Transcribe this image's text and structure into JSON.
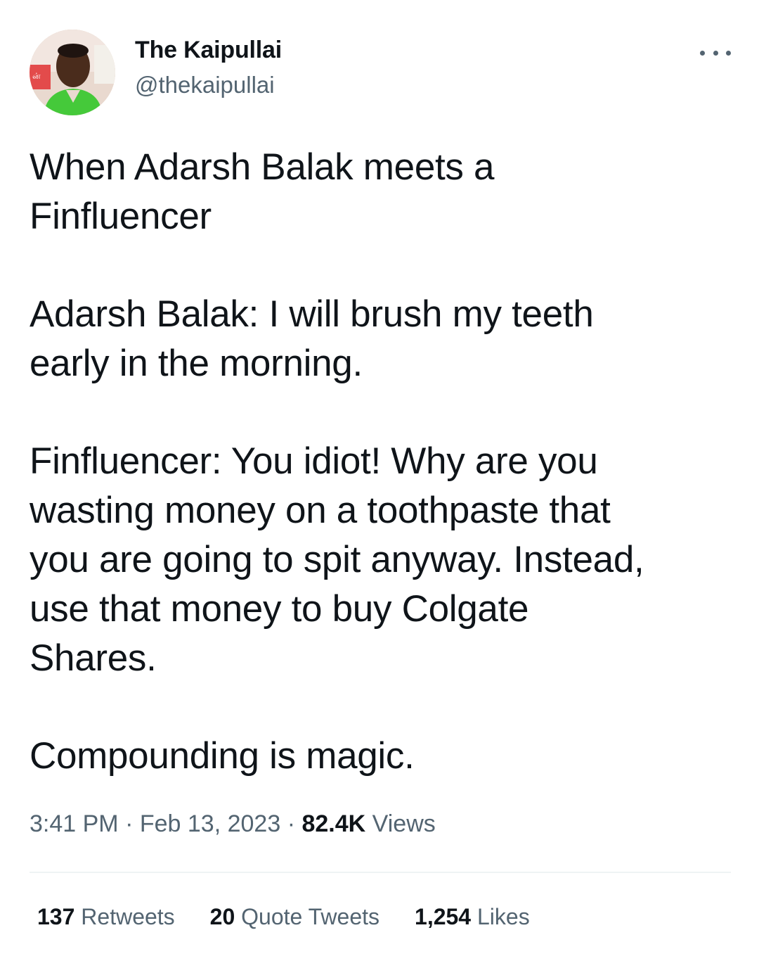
{
  "author": {
    "display_name": "The Kaipullai",
    "handle": "@thekaipullai",
    "avatar_icon": "profile-photo"
  },
  "more_icon": "more-horizontal-icon",
  "tweet": {
    "paragraphs": [
      {
        "lines": [
          "When Adarsh Balak meets a",
          "Finfluencer"
        ]
      },
      {
        "lines": [
          "Adarsh Balak: I will brush my teeth",
          "early in the morning."
        ]
      },
      {
        "lines": [
          "Finfluencer: You idiot! Why are you",
          "wasting money on a toothpaste that",
          "you are going to spit anyway. Instead,",
          "use that money to buy Colgate",
          "Shares."
        ]
      },
      {
        "lines": [
          "Compounding is magic."
        ]
      }
    ]
  },
  "meta": {
    "time": "3:41 PM",
    "separator": "·",
    "date": "Feb 13, 2023",
    "views_count": "82.4K",
    "views_label": "Views"
  },
  "stats": {
    "retweets_count": "137",
    "retweets_label": "Retweets",
    "quotes_count": "20",
    "quotes_label": "Quote Tweets",
    "likes_count": "1,254",
    "likes_label": "Likes"
  },
  "colors": {
    "text_primary": "#0f1419",
    "text_secondary": "#536471",
    "divider": "#eff3f4"
  }
}
